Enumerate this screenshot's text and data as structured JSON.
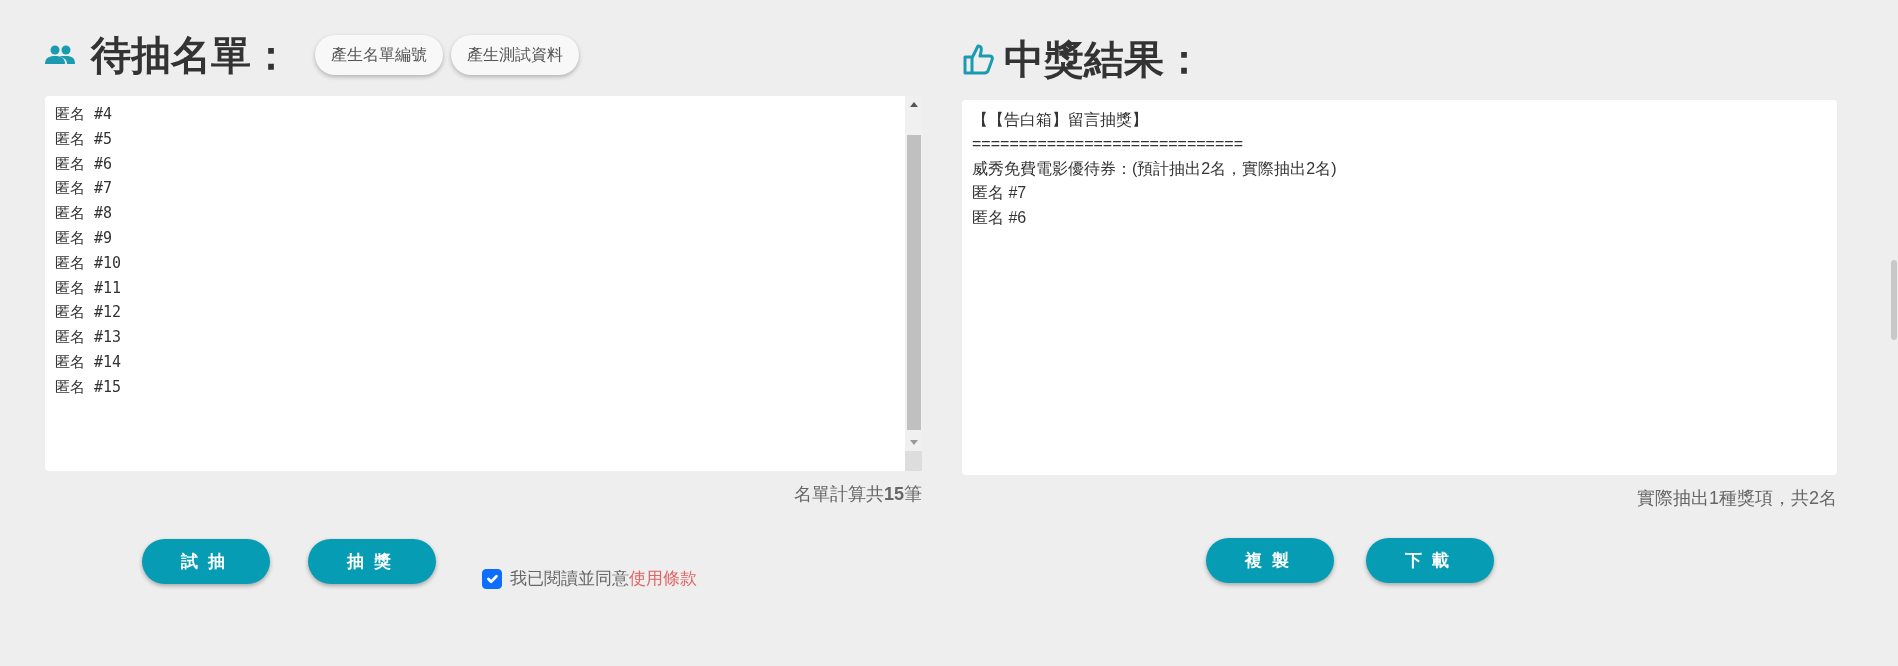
{
  "entry_list": {
    "title": "待抽名單：",
    "tool_buttons": [
      "產生名單編號",
      "產生測試資料"
    ],
    "entries": [
      "匿名 #4",
      "匿名 #5",
      "匿名 #6",
      "匿名 #7",
      "匿名 #8",
      "匿名 #9",
      "匿名 #10",
      "匿名 #11",
      "匿名 #12",
      "匿名 #13",
      "匿名 #14",
      "匿名 #15"
    ],
    "count": "名單計算共**15**筆",
    "action_buttons": [
      "試抽",
      "抽獎"
    ],
    "consent": {
      "checked": true,
      "text": "我已閱讀並同意",
      "link": "使用條款"
    }
  },
  "results": {
    "title": "中獎結果：",
    "lines": [
      "【【告白箱】留言抽獎】",
      "=============================",
      "威秀免費電影優待券：(預計抽出2名，實際抽出2名)",
      "匿名 #7",
      "匿名 #6"
    ],
    "summary": "實際抽出1種獎項，共2名",
    "action_buttons": [
      "複製",
      "下載"
    ]
  }
}
